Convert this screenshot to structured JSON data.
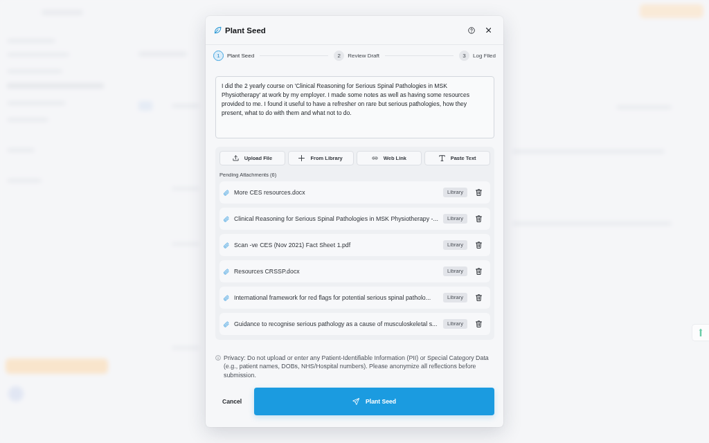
{
  "dialog": {
    "title": "Plant Seed"
  },
  "stepper": {
    "steps": [
      {
        "number": "1",
        "label": "Plant Seed",
        "active": true
      },
      {
        "number": "2",
        "label": "Review Draft",
        "active": false
      },
      {
        "number": "3",
        "label": "Log Filed",
        "active": false
      }
    ]
  },
  "reflection": {
    "value": "I did the 2 yearly course on 'Clinical Reasoning for Serious Spinal Pathologies in MSK Physiotherapy' at work by my employer. I made some notes as well as having some resources provided to me. I found it useful to have a refresher on rare but serious pathologies, how they present, what to do with them and what not to do."
  },
  "attach_buttons": [
    {
      "kind": "upload",
      "label": "Upload File"
    },
    {
      "kind": "library",
      "label": "From Library"
    },
    {
      "kind": "link",
      "label": "Web Link"
    },
    {
      "kind": "text",
      "label": "Paste Text"
    }
  ],
  "attachments": {
    "heading": "Pending Attachments (6)",
    "items": [
      {
        "name": "More CES resources.docx",
        "source": "Library"
      },
      {
        "name": "Clinical Reasoning for Serious Spinal Pathologies in MSK Physiotherapy -...",
        "source": "Library"
      },
      {
        "name": "Scan -ve CES (Nov 2021) Fact Sheet 1.pdf",
        "source": "Library"
      },
      {
        "name": "Resources CRSSP.docx",
        "source": "Library"
      },
      {
        "name": "International framework for red flags for potential serious spinal patholo...",
        "source": "Library"
      },
      {
        "name": "Guidance to recognise serious pathology as a cause of musculoskeletal s...",
        "source": "Library"
      }
    ]
  },
  "privacy_notice": "Privacy: Do not upload or enter any Patient-Identifiable Information (PII) or Special Category Data (e.g., patient names, DOBs, NHS/Hospital numbers). Please anonymize all reflections before submission.",
  "footer": {
    "cancel": "Cancel",
    "submit": "Plant Seed"
  }
}
